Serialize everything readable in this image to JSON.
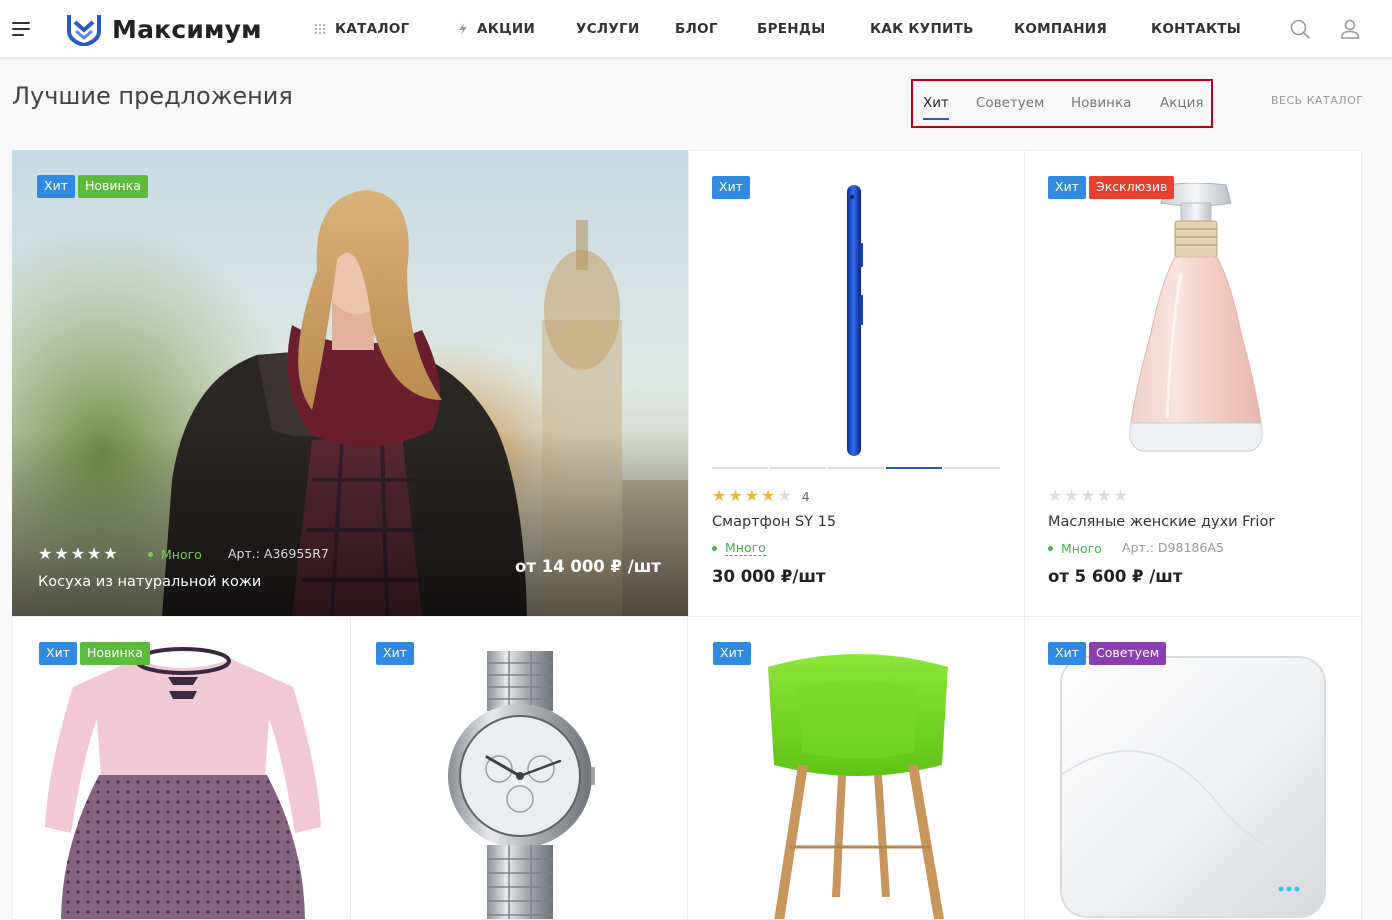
{
  "brand": {
    "name": "Максимум",
    "accent": "#2b59c3"
  },
  "nav": {
    "items": [
      "КАТАЛОГ",
      "АКЦИИ",
      "УСЛУГИ",
      "БЛОГ",
      "БРЕНДЫ",
      "КАК КУПИТЬ",
      "КОМПАНИЯ",
      "КОНТАКТЫ"
    ],
    "icons": [
      "menu-icon",
      "grid-icon",
      "lightning-icon",
      "search-icon",
      "user-icon"
    ]
  },
  "section": {
    "title": "Лучшие предложения",
    "tabs": [
      "Хит",
      "Советуем",
      "Новинка",
      "Акция"
    ],
    "active_tab": "Хит",
    "all_link": "ВЕСЬ КАТАЛОГ"
  },
  "badge_colors": {
    "Хит": "#2f8ae0",
    "Новинка": "#5cbb3c",
    "Эксклюзив": "#e8402e",
    "Советуем": "#8b3db2"
  },
  "products": [
    {
      "badges": [
        "Хит",
        "Новинка"
      ],
      "name": "Косуха из натуральной кожи",
      "rating": 5,
      "stock": "Много",
      "article": "Арт.: A36955R7",
      "price": "от 14 000 ₽ /шт",
      "image": "woman-leather-jacket-photo"
    },
    {
      "badges": [
        "Хит"
      ],
      "name": "Смартфон SY 15",
      "rating": 4,
      "rating_count": "4",
      "stock": "Много",
      "price": "30 000 ₽/шт",
      "image": "smartphone-photo"
    },
    {
      "badges": [
        "Хит",
        "Эксклюзив"
      ],
      "name": "Масляные женские духи Frior",
      "rating": 0,
      "stock": "Много",
      "article": "Арт.: D98186A5",
      "price": "от 5 600 ₽ /шт",
      "image": "perfume-bottle-photo"
    },
    {
      "badges": [
        "Хит",
        "Новинка"
      ],
      "image": "kids-dress-photo"
    },
    {
      "badges": [
        "Хит"
      ],
      "image": "wrist-watch-photo"
    },
    {
      "badges": [
        "Хит"
      ],
      "image": "green-chair-photo"
    },
    {
      "badges": [
        "Хит",
        "Советуем"
      ],
      "image": "white-router-photo"
    }
  ]
}
